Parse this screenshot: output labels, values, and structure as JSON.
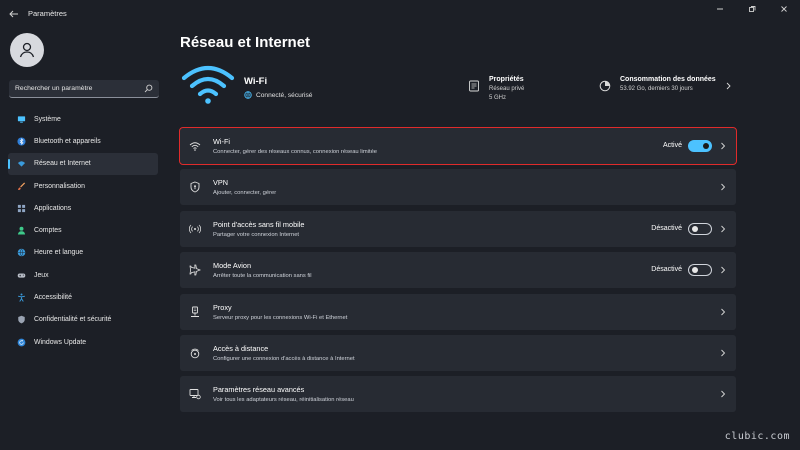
{
  "window": {
    "title": "Paramètres"
  },
  "sidebar": {
    "search": {
      "placeholder": "Rechercher un paramètre"
    },
    "items": [
      {
        "label": "Système",
        "icon": "monitor-icon",
        "active": false
      },
      {
        "label": "Bluetooth et appareils",
        "icon": "bluetooth-icon",
        "active": false
      },
      {
        "label": "Réseau et Internet",
        "icon": "wifi-icon",
        "active": true
      },
      {
        "label": "Personnalisation",
        "icon": "brush-icon",
        "active": false
      },
      {
        "label": "Applications",
        "icon": "apps-icon",
        "active": false
      },
      {
        "label": "Comptes",
        "icon": "person-icon",
        "active": false
      },
      {
        "label": "Heure et langue",
        "icon": "globe-clock-icon",
        "active": false
      },
      {
        "label": "Jeux",
        "icon": "gamepad-icon",
        "active": false
      },
      {
        "label": "Accessibilité",
        "icon": "accessibility-icon",
        "active": false
      },
      {
        "label": "Confidentialité et sécurité",
        "icon": "shield-icon",
        "active": false
      },
      {
        "label": "Windows Update",
        "icon": "update-icon",
        "active": false
      }
    ]
  },
  "main": {
    "title": "Réseau et Internet",
    "connection": {
      "name": "Wi-Fi",
      "status": "Connecté, sécurisé",
      "properties": {
        "title": "Propriétés",
        "line1": "Réseau privé",
        "line2": "5 GHz"
      },
      "usage": {
        "title": "Consommation des données",
        "detail": "53.92 Go, derniers 30 jours"
      }
    },
    "cards": [
      {
        "title": "Wi-Fi",
        "subtitle": "Connecter, gérer des réseaux connus, connexion réseau limitée",
        "status": "Activé",
        "toggle": "on",
        "icon": "wifi-icon"
      },
      {
        "title": "VPN",
        "subtitle": "Ajouter, connecter, gérer",
        "status": "",
        "toggle": "none",
        "icon": "vpn-shield-icon"
      },
      {
        "title": "Point d'accès sans fil mobile",
        "subtitle": "Partager votre connexion Internet",
        "status": "Désactivé",
        "toggle": "off",
        "icon": "hotspot-icon"
      },
      {
        "title": "Mode Avion",
        "subtitle": "Arrêter toute la communication sans fil",
        "status": "Désactivé",
        "toggle": "off",
        "icon": "airplane-icon"
      },
      {
        "title": "Proxy",
        "subtitle": "Serveur proxy pour les connexions Wi-Fi et Ethernet",
        "status": "",
        "toggle": "none",
        "icon": "proxy-icon"
      },
      {
        "title": "Accès à distance",
        "subtitle": "Configurer une connexion d'accès à distance à Internet",
        "status": "",
        "toggle": "none",
        "icon": "dialup-icon"
      },
      {
        "title": "Paramètres réseau avancés",
        "subtitle": "Voir tous les adaptateurs réseau, réinitialisation réseau",
        "status": "",
        "toggle": "none",
        "icon": "advanced-network-icon"
      }
    ]
  },
  "watermark": "clubic.com",
  "colors": {
    "background": "#1c1f26",
    "card": "#272b33",
    "accent": "#4cc2ff",
    "highlight": "#e02b2b"
  }
}
